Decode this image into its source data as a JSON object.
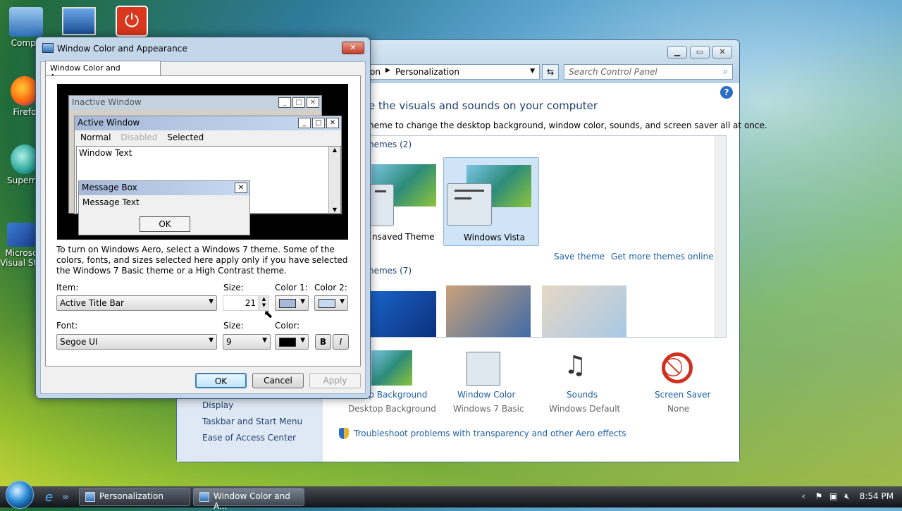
{
  "desktop": {
    "icons": [
      {
        "label": "Compu"
      },
      {
        "label": "Firefo"
      },
      {
        "label": "Supermi"
      },
      {
        "label": "Microsc Visual Stu"
      }
    ]
  },
  "control_panel": {
    "breadcrumb_partial": "on",
    "breadcrumb": "Personalization",
    "search_placeholder": "Search Control Panel",
    "heading_partial": "e the visuals and sounds on your computer",
    "subheading_partial": "heme to change the desktop background, window color, sounds, and screen saver all at once.",
    "my_themes_partial": "hemes (2)",
    "unsaved_theme_partial": "nsaved Theme",
    "windows_vista_theme": "Windows Vista",
    "save_theme": "Save theme",
    "get_more_themes": "Get more themes online",
    "aero_themes_partial": "hemes (7)",
    "settings": [
      {
        "title": "op Background",
        "subtitle": "Desktop Background"
      },
      {
        "title": "Window Color",
        "subtitle": "Windows 7 Basic"
      },
      {
        "title": "Sounds",
        "subtitle": "Windows Default"
      },
      {
        "title": "Screen Saver",
        "subtitle": "None"
      }
    ],
    "see_also": [
      "Display",
      "Taskbar and Start Menu",
      "Ease of Access Center"
    ],
    "troubleshoot": "Troubleshoot problems with transparency and other Aero effects"
  },
  "dialog": {
    "title": "Window Color and Appearance",
    "tab": "Window Color and Appearance",
    "preview": {
      "inactive_window": "Inactive Window",
      "active_window": "Active Window",
      "menu_normal": "Normal",
      "menu_disabled": "Disabled",
      "menu_selected": "Selected",
      "window_text": "Window Text",
      "message_box": "Message Box",
      "message_text": "Message Text",
      "ok": "OK"
    },
    "info": "To turn on Windows Aero, select a Windows 7 theme.  Some of the colors, fonts, and sizes selected here apply only if you have selected the Windows 7 Basic theme or a High Contrast theme.",
    "item_label": "Item:",
    "item_value": "Active Title Bar",
    "size_label": "Size:",
    "size_value": "21",
    "color1_label": "Color 1:",
    "color2_label": "Color 2:",
    "color1": "#a6b9d8",
    "color2": "#c7daf2",
    "font_label": "Font:",
    "font_value": "Segoe UI",
    "font_size_label": "Size:",
    "font_size_value": "9",
    "font_color_label": "Color:",
    "font_color": "#000000",
    "bold": "B",
    "italic": "I",
    "ok_button": "OK",
    "cancel_button": "Cancel",
    "apply_button": "Apply"
  },
  "taskbar": {
    "tasks": [
      "Personalization",
      "Window Color and A..."
    ],
    "clock": "8:54 PM"
  }
}
